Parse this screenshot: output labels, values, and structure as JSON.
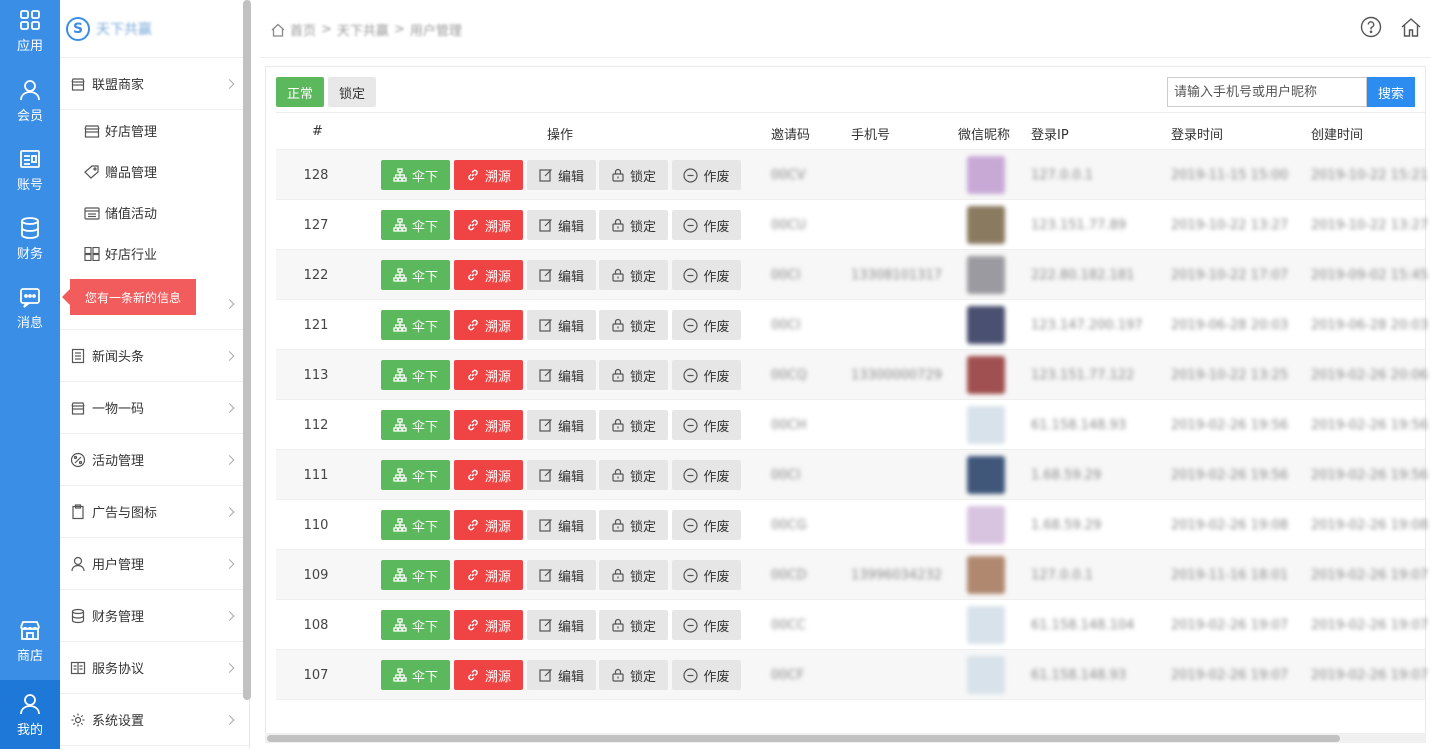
{
  "rail": {
    "items": [
      {
        "label": "应用",
        "icon": "apps-icon"
      },
      {
        "label": "会员",
        "icon": "user-icon"
      },
      {
        "label": "账号",
        "icon": "id-card-icon"
      },
      {
        "label": "财务",
        "icon": "database-icon"
      },
      {
        "label": "消息",
        "icon": "message-icon"
      },
      {
        "label": "商店",
        "icon": "store-icon"
      },
      {
        "label": "我的",
        "icon": "user-icon"
      }
    ]
  },
  "brand": {
    "logo": "S",
    "name": "天下共赢"
  },
  "menu": {
    "group1": "联盟商家",
    "sub": [
      "好店管理",
      "赠品管理",
      "储值活动",
      "好店行业"
    ],
    "groups": [
      "新闻头条",
      "一物一码",
      "活动管理",
      "广告与图标",
      "用户管理",
      "财务管理",
      "服务协议",
      "系统设置"
    ]
  },
  "toast": "您有一条新的信息",
  "breadcrumb": {
    "home": "首页",
    "sep": ">",
    "level1": "天下共赢",
    "level2": "用户管理"
  },
  "tabs": {
    "normal": "正常",
    "locked": "锁定"
  },
  "search": {
    "placeholder": "请输入手机号或用户昵称",
    "button": "搜索"
  },
  "columns": {
    "id": "#",
    "ops": "操作",
    "invite": "邀请码",
    "phone": "手机号",
    "nick": "微信昵称",
    "ip": "登录IP",
    "login_time": "登录时间",
    "create_time": "创建时间"
  },
  "actions": {
    "umbrella": "伞下",
    "trace": "溯源",
    "edit": "编辑",
    "lock": "锁定",
    "void": "作废"
  },
  "rows": [
    {
      "id": "128",
      "code": "00CV",
      "phone": "",
      "ip": "127.0.0.1",
      "login": "2019-11-15 15:00",
      "create": "2019-10-22 15:21",
      "avatar": "#c8a9d6"
    },
    {
      "id": "127",
      "code": "00CU",
      "phone": "",
      "ip": "123.151.77.89",
      "login": "2019-10-22 13:27",
      "create": "2019-10-22 13:27",
      "avatar": "#8a7a60"
    },
    {
      "id": "122",
      "code": "00CI",
      "phone": "13308101317",
      "ip": "222.80.182.181",
      "login": "2019-10-22 17:07",
      "create": "2019-09-02 15:45",
      "avatar": "#9a9aa0"
    },
    {
      "id": "121",
      "code": "00CI",
      "phone": "",
      "ip": "123.147.200.197",
      "login": "2019-06-28 20:03",
      "create": "2019-06-28 20:03",
      "avatar": "#4a5070"
    },
    {
      "id": "113",
      "code": "00CQ",
      "phone": "13300000729",
      "ip": "123.151.77.122",
      "login": "2019-10-22 13:25",
      "create": "2019-02-26 20:06",
      "avatar": "#a05050"
    },
    {
      "id": "112",
      "code": "00CH",
      "phone": "",
      "ip": "61.158.148.93",
      "login": "2019-02-26 19:56",
      "create": "2019-02-26 19:56",
      "avatar": "#d8e2ea"
    },
    {
      "id": "111",
      "code": "00CI",
      "phone": "",
      "ip": "1.68.59.29",
      "login": "2019-02-26 19:56",
      "create": "2019-02-26 19:56",
      "avatar": "#40577a"
    },
    {
      "id": "110",
      "code": "00CG",
      "phone": "",
      "ip": "1.68.59.29",
      "login": "2019-02-26 19:08",
      "create": "2019-02-26 19:08",
      "avatar": "#d8c4e0"
    },
    {
      "id": "109",
      "code": "00CD",
      "phone": "13996034232",
      "ip": "127.0.0.1",
      "login": "2019-11-16 18:01",
      "create": "2019-02-26 19:07",
      "avatar": "#b08870"
    },
    {
      "id": "108",
      "code": "00CC",
      "phone": "",
      "ip": "61.158.148.104",
      "login": "2019-02-26 19:07",
      "create": "2019-02-26 19:07",
      "avatar": "#d8e2ea"
    },
    {
      "id": "107",
      "code": "00CF",
      "phone": "",
      "ip": "61.158.148.93",
      "login": "2019-02-26 19:07",
      "create": "2019-02-26 19:07",
      "avatar": "#d8e2ea"
    }
  ]
}
